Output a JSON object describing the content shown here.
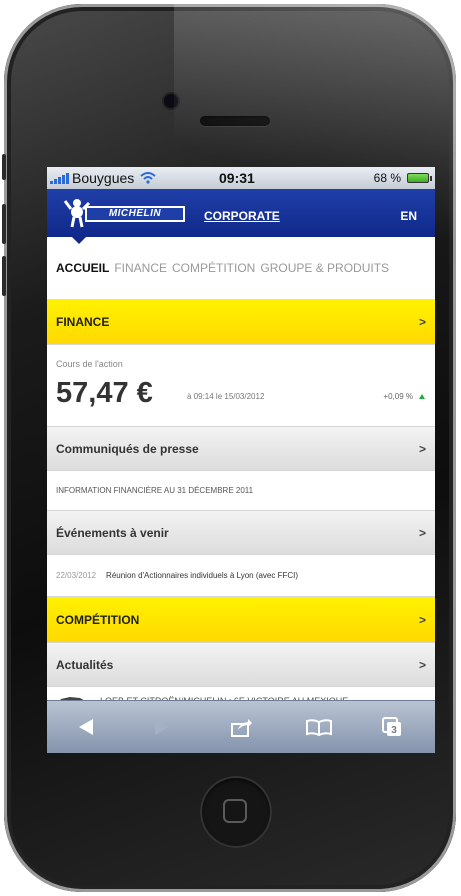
{
  "status_bar": {
    "carrier": "Bouygues",
    "time": "09:31",
    "battery_percent": "68 %"
  },
  "header": {
    "logo_text": "MICHELIN",
    "corporate_link": "CORPORATE",
    "language": "EN"
  },
  "tabs": [
    {
      "label": "ACCUEIL",
      "active": true
    },
    {
      "label": "FINANCE",
      "active": false
    },
    {
      "label": "COMPÉTITION",
      "active": false
    },
    {
      "label": "GROUPE & PRODUITS",
      "active": false
    }
  ],
  "finance_section": {
    "title": "FINANCE",
    "stock_label": "Cours de l'action",
    "stock_price": "57,47 €",
    "stock_time": "à 09:14 le 15/03/2012",
    "stock_change": "+0,09 %"
  },
  "press_releases": {
    "title": "Communiqués de presse",
    "item": "INFORMATION FINANCIÈRE AU 31 DÉCEMBRE 2011"
  },
  "upcoming_events": {
    "title": "Événements à venir",
    "date": "22/03/2012",
    "item": "Réunion d'Actionnaires individuels à Lyon (avec FFCI)"
  },
  "competition_section": {
    "title": "COMPÉTITION"
  },
  "news": {
    "title": "Actualités",
    "item": "LOEB ET CITROËN/MICHELIN : 6E VICTOIRE AU MEXIQUE"
  },
  "chevron": ">",
  "toolbar": {
    "tabs_count": "3",
    "icons": [
      "back-icon",
      "forward-icon",
      "share-icon",
      "bookmarks-icon",
      "tabs-icon"
    ]
  },
  "colors": {
    "brand_blue": "#1f3fa8",
    "accent_yellow": "#ffe800",
    "positive_green": "#25a843"
  }
}
